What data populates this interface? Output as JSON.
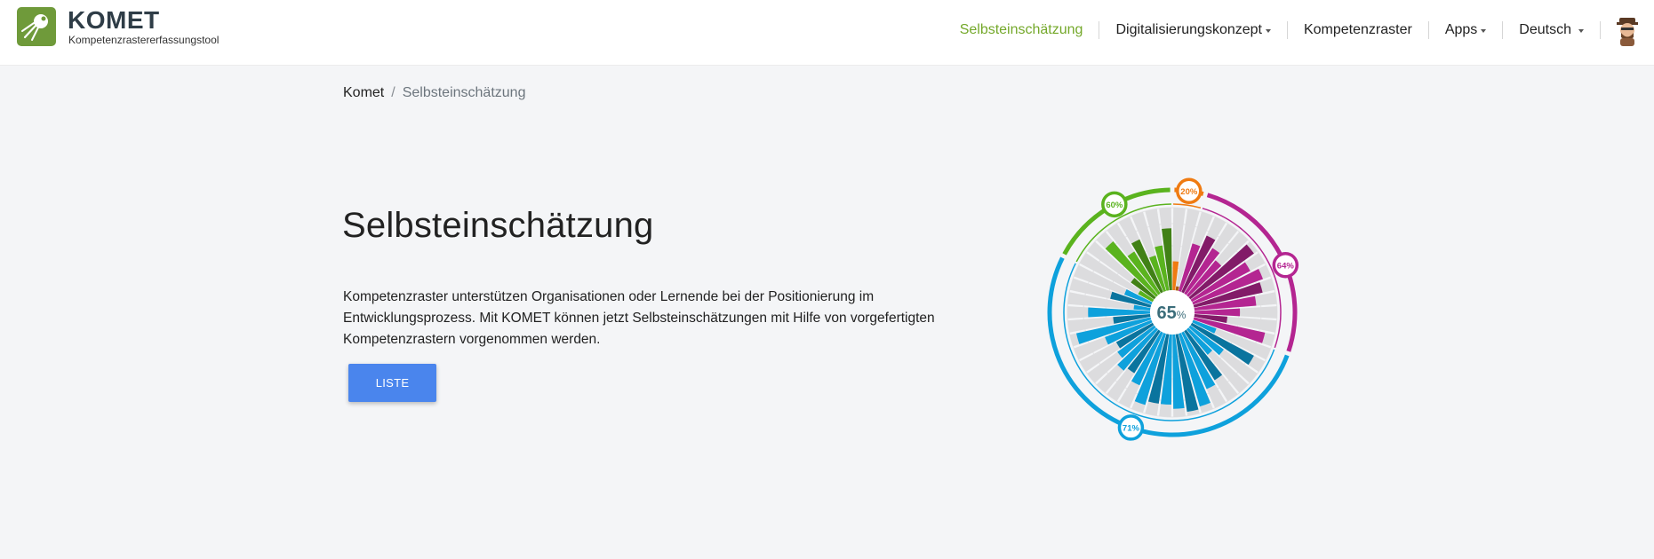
{
  "app": {
    "brand_name": "KOMET",
    "brand_subtitle": "Kompetenzrastererfassungstool"
  },
  "nav": {
    "items": [
      {
        "label": "Selbsteinschätzung",
        "active": true,
        "dropdown": false
      },
      {
        "label": "Digitalisierungskonzept",
        "active": false,
        "dropdown": true
      },
      {
        "label": "Kompetenzraster",
        "active": false,
        "dropdown": false
      },
      {
        "label": "Apps",
        "active": false,
        "dropdown": true
      },
      {
        "label": "Deutsch",
        "active": false,
        "dropdown": true
      }
    ],
    "avatar_icon": "user-avatar-icon"
  },
  "breadcrumb": {
    "home": "Komet",
    "separator": "/",
    "current": "Selbsteinschätzung"
  },
  "main": {
    "title": "Selbsteinschätzung",
    "intro": "Kompetenzraster unterstützen Organisationen oder Lernende bei der Positionierung im Entwicklungsprozess. Mit KOMET können jetzt Selbsteinschätzungen mit Hilfe von vorgefertigten Kompetenzrastern vorgenommen werden.",
    "button_label": "LISTE"
  },
  "colors": {
    "accent_green": "#74a82a",
    "button_blue": "#4a85ed",
    "seg_orange": "#ef7b12",
    "seg_magenta": "#b42591",
    "seg_blue": "#0ea1dc",
    "seg_green": "#5ab31e",
    "empty": "#dcdcde"
  },
  "chart_data": {
    "type": "radial-bar",
    "center_value": "65",
    "center_unit": "%",
    "groups": [
      {
        "label": "20%",
        "percent": 20,
        "color": "#ef7b12",
        "bars": [
          0.35,
          0.05
        ]
      },
      {
        "label": "64%",
        "percent": 64,
        "color": "#b42591",
        "bars": [
          0.6,
          0.75,
          0.65,
          0.55,
          0.95,
          0.8,
          0.9,
          0.85,
          0.75,
          0.55,
          0.4,
          0.88
        ]
      },
      {
        "label": "71%",
        "percent": 71,
        "color": "#0ea1dc",
        "bars": [
          0.3,
          0.85,
          0.5,
          0.4,
          0.7,
          0.75,
          0.92,
          0.95,
          0.9,
          0.85,
          0.85,
          0.9,
          0.7,
          0.6,
          0.65,
          0.55,
          0.5,
          0.6,
          0.92,
          0.45,
          0.75,
          0.2,
          0.5,
          0.35
        ]
      },
      {
        "label": "60%",
        "percent": 60,
        "color": "#5ab31e",
        "bars": [
          0.2,
          0.35,
          0.85,
          0.6,
          0.7,
          0.45,
          0.55,
          0.75
        ]
      }
    ]
  }
}
